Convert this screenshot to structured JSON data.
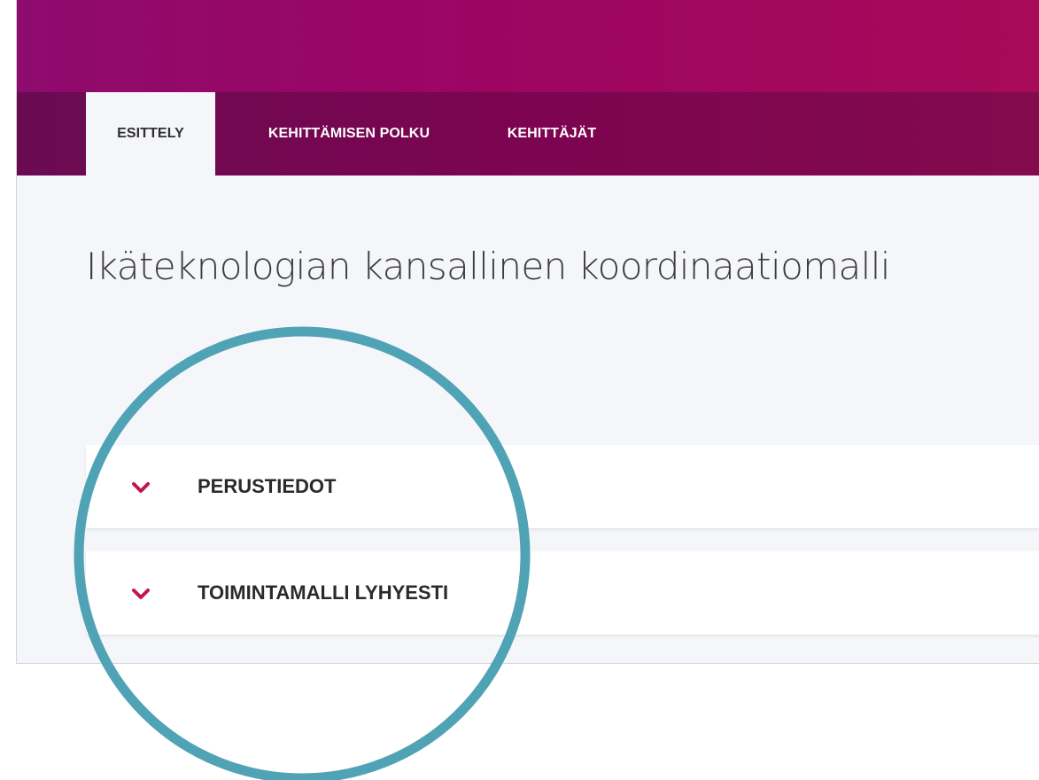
{
  "nav": {
    "tabs": [
      {
        "label": "ESITTELY",
        "active": true
      },
      {
        "label": "KEHITTÄMISEN POLKU",
        "active": false
      },
      {
        "label": "KEHITTÄJÄT",
        "active": false
      }
    ]
  },
  "main": {
    "title": "Ikäteknologian kansallinen koordinaatiomalli",
    "accordions": [
      {
        "label": "PERUSTIEDOT",
        "icon": "chevron-down-icon"
      },
      {
        "label": "TOIMINTAMALLI LYHYESTI",
        "icon": "chevron-down-icon"
      }
    ]
  },
  "colors": {
    "header_top": "#9d0563",
    "nav_bar": "#7c0450",
    "accent_chevron": "#c2134f",
    "highlight_ring": "#4fa3b5",
    "page_background": "#f5f6f9"
  }
}
